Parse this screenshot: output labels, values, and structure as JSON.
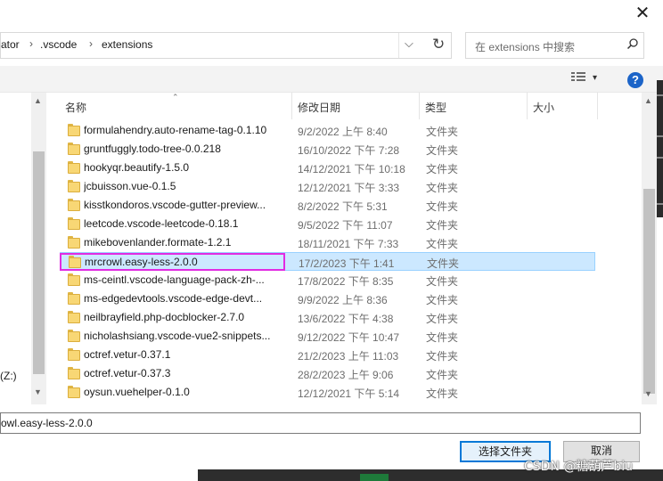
{
  "window": {
    "close_glyph": "✕"
  },
  "address_bar": {
    "segments": [
      "ator",
      ".vscode",
      "extensions"
    ],
    "separator": "›",
    "dropdown_glyph": "⌵",
    "refresh_glyph": "↻"
  },
  "search": {
    "placeholder": "在 extensions 中搜索",
    "icon": "search-icon"
  },
  "toolbar": {
    "view_icon": "details-view-icon",
    "view_dropdown": "▾",
    "help_label": "?"
  },
  "columns": {
    "name": "名称",
    "date": "修改日期",
    "type": "类型",
    "size": "大小",
    "sort_indicator": "⌃"
  },
  "files": [
    {
      "name": "formulahendry.auto-rename-tag-0.1.10",
      "date": "9/2/2022 上午 8:40",
      "type": "文件夹"
    },
    {
      "name": "gruntfuggly.todo-tree-0.0.218",
      "date": "16/10/2022 下午 7:28",
      "type": "文件夹"
    },
    {
      "name": "hookyqr.beautify-1.5.0",
      "date": "14/12/2021 下午 10:18",
      "type": "文件夹"
    },
    {
      "name": "jcbuisson.vue-0.1.5",
      "date": "12/12/2021 下午 3:33",
      "type": "文件夹"
    },
    {
      "name": "kisstkondoros.vscode-gutter-preview...",
      "date": "8/2/2022 下午 5:31",
      "type": "文件夹"
    },
    {
      "name": "leetcode.vscode-leetcode-0.18.1",
      "date": "9/5/2022 下午 11:07",
      "type": "文件夹"
    },
    {
      "name": "mikebovenlander.formate-1.2.1",
      "date": "18/11/2021 下午 7:33",
      "type": "文件夹"
    },
    {
      "name": "mrcrowl.easy-less-2.0.0",
      "date": "17/2/2023 下午 1:41",
      "type": "文件夹",
      "selected": true
    },
    {
      "name": "ms-ceintl.vscode-language-pack-zh-...",
      "date": "17/8/2022 下午 8:35",
      "type": "文件夹"
    },
    {
      "name": "ms-edgedevtools.vscode-edge-devt...",
      "date": "9/9/2022 上午 8:36",
      "type": "文件夹"
    },
    {
      "name": "neilbrayfield.php-docblocker-2.7.0",
      "date": "13/6/2022 下午 4:38",
      "type": "文件夹"
    },
    {
      "name": "nicholashsiang.vscode-vue2-snippets...",
      "date": "9/12/2022 下午 10:47",
      "type": "文件夹"
    },
    {
      "name": "octref.vetur-0.37.1",
      "date": "21/2/2023 上午 11:03",
      "type": "文件夹"
    },
    {
      "name": "octref.vetur-0.37.3",
      "date": "28/2/2023 上午 9:06",
      "type": "文件夹"
    },
    {
      "name": "oysun.vuehelper-0.1.0",
      "date": "12/12/2021 下午 5:14",
      "type": "文件夹"
    }
  ],
  "nav": {
    "drive_label": "(Z:)"
  },
  "footer": {
    "filename_value": "owl.easy-less-2.0.0",
    "select_button": "选择文件夹",
    "cancel_button": "取消"
  },
  "watermark": "CSDN @糖葫芦biu",
  "colors": {
    "selection": "#cce8ff",
    "highlight_box": "#e22be2",
    "help": "#1c64c8",
    "primary_border": "#0078d7"
  }
}
